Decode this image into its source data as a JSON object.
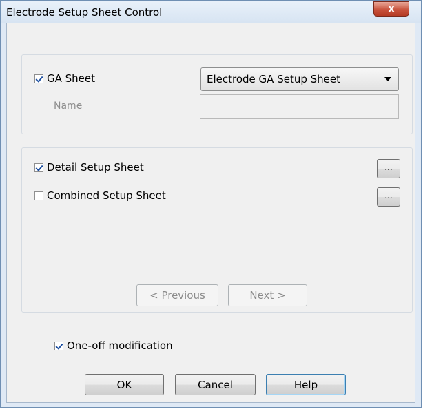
{
  "window": {
    "title": "Electrode Setup Sheet Control",
    "close_label": "x"
  },
  "ga_group": {
    "ga_sheet_label": "GA Sheet",
    "ga_sheet_checked": true,
    "template_select": "Electrode GA Setup Sheet",
    "name_label": "Name",
    "name_value": ""
  },
  "sheets_group": {
    "detail_label": "Detail Setup Sheet",
    "detail_checked": true,
    "detail_more": "...",
    "combined_label": "Combined Setup Sheet",
    "combined_checked": false,
    "combined_more": "...",
    "previous_label": "< Previous",
    "next_label": "Next >"
  },
  "oneoff_label": "One-off modification",
  "oneoff_checked": true,
  "buttons": {
    "ok": "OK",
    "cancel": "Cancel",
    "help": "Help"
  }
}
